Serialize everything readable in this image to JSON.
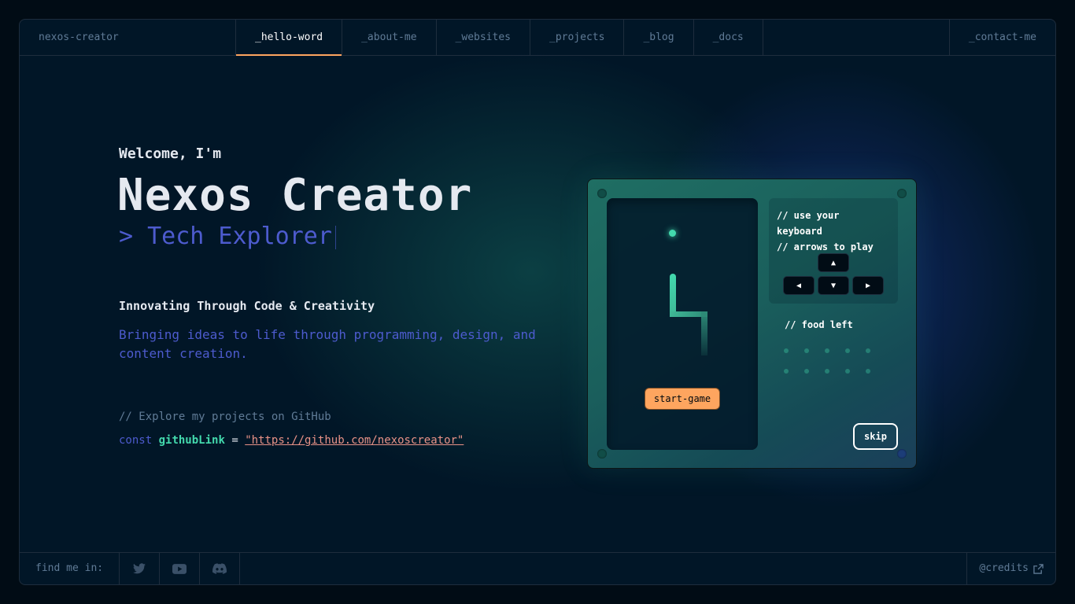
{
  "header": {
    "brand": "nexos-creator",
    "tabs": [
      "_hello-word",
      "_about-me",
      "_websites",
      "_projects",
      "_blog",
      "_docs"
    ],
    "active_tab": "_hello-word",
    "contact": "_contact-me"
  },
  "hero": {
    "welcome": "Welcome, I'm",
    "name": "Nexos Creator",
    "role": "> Tech Explorer",
    "tagline": "Innovating Through Code & Creativity",
    "description": "Bringing ideas to life through programming, design, and content creation.",
    "comment": "// Explore my projects on GitHub",
    "code_keyword": "const",
    "code_var": "githubLink",
    "code_eq": "=",
    "code_value": "\"https://github.com/nexoscreator\""
  },
  "game": {
    "hint_line1": "// use your keyboard",
    "hint_line2": "// arrows to play",
    "keys": {
      "up": "▲",
      "left": "◀",
      "down": "▼",
      "right": "▶"
    },
    "start_label": "start-game",
    "food_left_label": "// food left",
    "food_left_count": 10,
    "skip_label": "skip"
  },
  "footer": {
    "find_label": "find me in:",
    "socials": [
      "twitter-icon",
      "youtube-icon",
      "discord-icon"
    ],
    "credits": "@credits"
  },
  "colors": {
    "background": "#011627",
    "accent_orange": "#fea55f",
    "accent_green": "#43d9ad",
    "accent_purple": "#4d5bce",
    "string": "#e99287"
  }
}
